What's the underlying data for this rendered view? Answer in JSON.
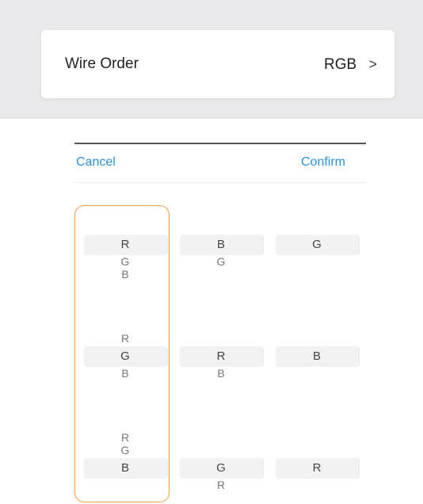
{
  "setting": {
    "label": "Wire Order",
    "value": "RGB",
    "chevron": ">"
  },
  "picker": {
    "cancel": "Cancel",
    "confirm": "Confirm"
  },
  "rows": [
    {
      "options": [
        {
          "selected": "R",
          "above": [],
          "below": [
            "G",
            "B"
          ]
        },
        {
          "selected": "B",
          "above": [],
          "below": [
            "G"
          ]
        },
        {
          "selected": "G",
          "above": [],
          "below": []
        }
      ]
    },
    {
      "options": [
        {
          "selected": "G",
          "above": [
            "R"
          ],
          "below": [
            "B"
          ]
        },
        {
          "selected": "R",
          "above": [],
          "below": [
            "B"
          ]
        },
        {
          "selected": "B",
          "above": [],
          "below": []
        }
      ]
    },
    {
      "options": [
        {
          "selected": "B",
          "above": [
            "R",
            "G"
          ],
          "below": []
        },
        {
          "selected": "G",
          "above": [],
          "below": [
            "R"
          ]
        },
        {
          "selected": "R",
          "above": [],
          "below": []
        }
      ]
    }
  ]
}
